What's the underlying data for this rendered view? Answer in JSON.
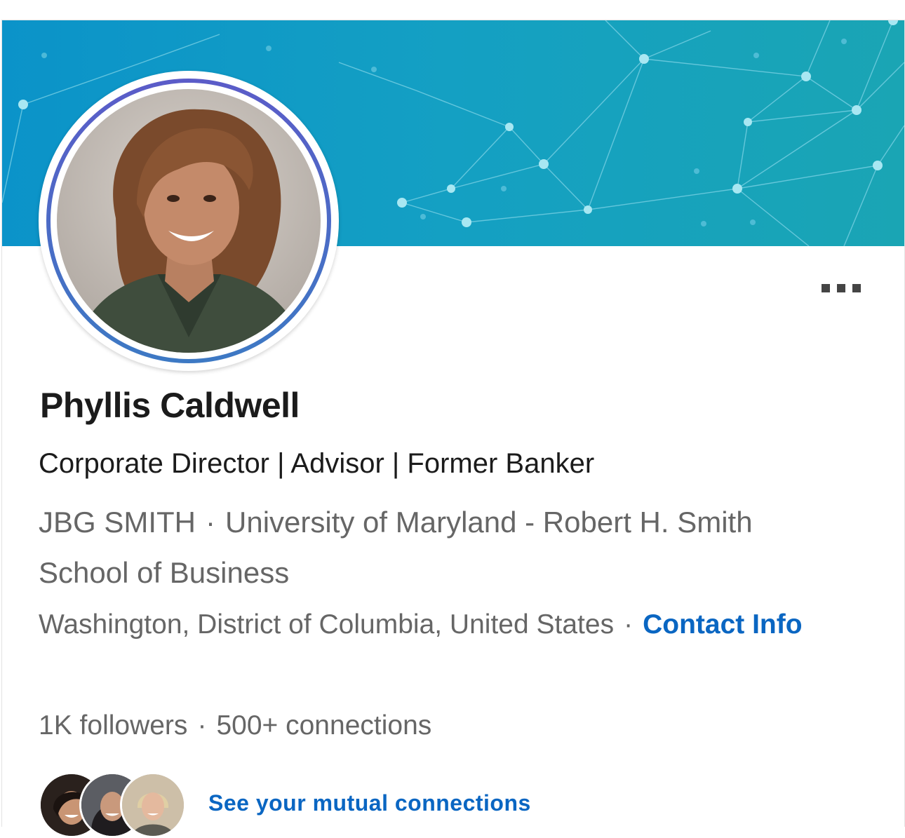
{
  "profile": {
    "name": "Phyllis Caldwell",
    "headline": "Corporate Director | Advisor | Former Banker",
    "company": "JBG SMITH",
    "education": "University of Maryland - Robert H. Smith School of Business",
    "location": "Washington, District of Columbia, United States",
    "contact_label": "Contact Info",
    "followers": "1K followers",
    "connections": "500+ connections",
    "mutual_label": "See your mutual connections",
    "separator": "·"
  },
  "colors": {
    "banner_start": "#0e9bc7",
    "banner_end": "#1aa3b3",
    "link": "#0a66c2",
    "ring": "#5a5fc4"
  },
  "icons": {
    "more": "more-horizontal-icon"
  }
}
